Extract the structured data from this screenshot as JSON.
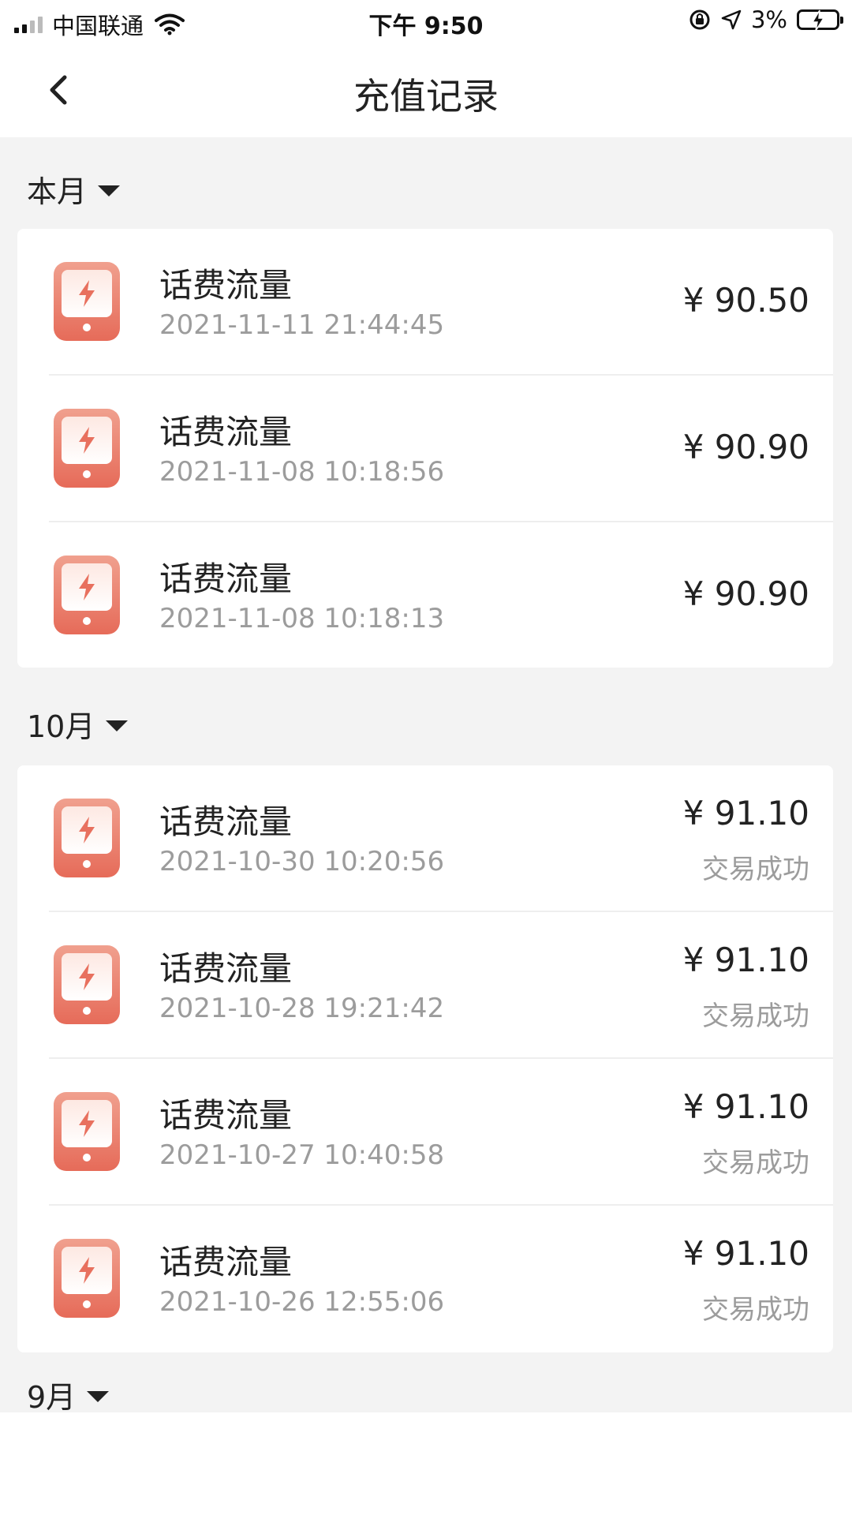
{
  "status_bar": {
    "carrier": "中国联通",
    "time": "下午 9:50",
    "battery": "3%"
  },
  "nav": {
    "title": "充值记录"
  },
  "months": [
    {
      "label": "本月",
      "records": [
        {
          "title": "话费流量",
          "time": "2021-11-11 21:44:45",
          "amount": "¥ 90.50",
          "status": ""
        },
        {
          "title": "话费流量",
          "time": "2021-11-08 10:18:56",
          "amount": "¥ 90.90",
          "status": ""
        },
        {
          "title": "话费流量",
          "time": "2021-11-08 10:18:13",
          "amount": "¥ 90.90",
          "status": ""
        }
      ]
    },
    {
      "label": "10月",
      "records": [
        {
          "title": "话费流量",
          "time": "2021-10-30 10:20:56",
          "amount": "¥ 91.10",
          "status": "交易成功"
        },
        {
          "title": "话费流量",
          "time": "2021-10-28 19:21:42",
          "amount": "¥ 91.10",
          "status": "交易成功"
        },
        {
          "title": "话费流量",
          "time": "2021-10-27 10:40:58",
          "amount": "¥ 91.10",
          "status": "交易成功"
        },
        {
          "title": "话费流量",
          "time": "2021-10-26 12:55:06",
          "amount": "¥ 91.10",
          "status": "交易成功"
        }
      ]
    },
    {
      "label": "9月",
      "records": []
    }
  ],
  "colors": {
    "icon_top": "#f0a08e",
    "icon_bottom": "#e66b59",
    "background": "#f3f3f3",
    "secondary_text": "#9c9c9c"
  },
  "icons": {
    "back": "chevron-left-icon",
    "record": "phone-bolt-icon",
    "month_toggle": "caret-down-icon"
  }
}
